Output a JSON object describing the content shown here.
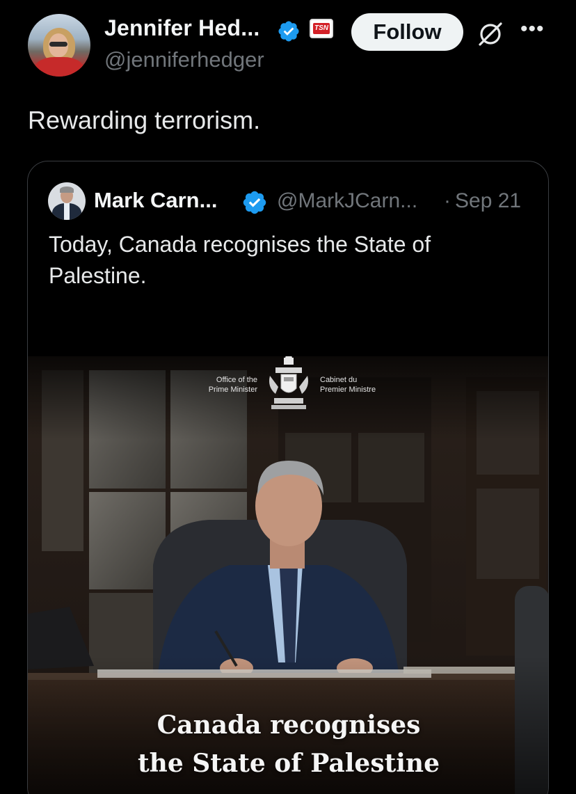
{
  "author": {
    "display_name": "Jennifer Hed...",
    "handle": "@jenniferhedger",
    "badge_label": "TSN"
  },
  "actions": {
    "follow_label": "Follow",
    "grok_icon": "grok-icon",
    "more_label": "•••"
  },
  "tweet": {
    "text": "Rewarding terrorism."
  },
  "quoted": {
    "display_name": "Mark Carn...",
    "handle": "@MarkJCarn...",
    "separator": "·",
    "date": "Sep 21",
    "text": "Today, Canada recognises the State of Palestine.",
    "media": {
      "office_en_line1": "Office of the",
      "office_en_line2": "Prime Minister",
      "office_fr_line1": "Cabinet du",
      "office_fr_line2": "Premier Ministre",
      "caption_line1": "Canada recognises",
      "caption_line2": "the State of Palestine"
    }
  },
  "colors": {
    "background": "#000000",
    "verified_blue": "#1d9bf0",
    "secondary_text": "#71767b",
    "primary_text": "#e7e9ea",
    "follow_bg": "#eff3f4",
    "tsn_red": "#d32027"
  }
}
